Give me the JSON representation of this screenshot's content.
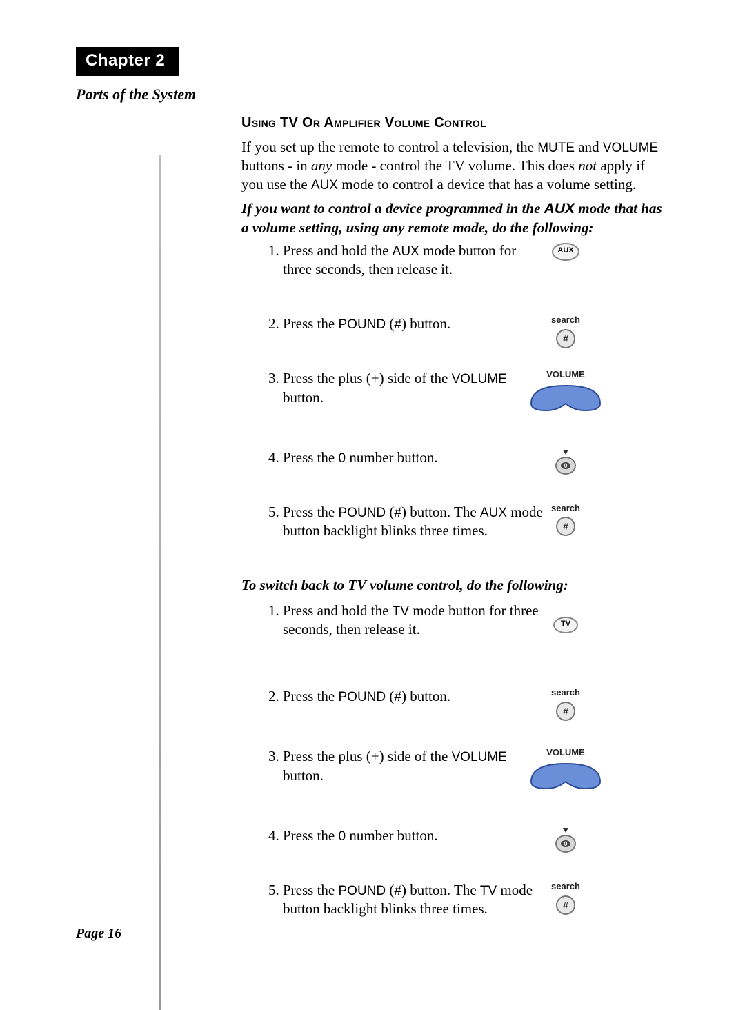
{
  "chapter": "Chapter 2",
  "section": "Parts of the System",
  "heading1": "Using TV Or Amplifier Volume Control",
  "intro_plain_a": "If you set up the remote to control a television, the ",
  "intro_mute": "MUTE",
  "intro_plain_b": " and ",
  "intro_volume": "VOLUME",
  "intro_plain_c": " buttons - in ",
  "intro_any": "any",
  "intro_plain_d": " mode - control the TV volume. This does ",
  "intro_not": "not",
  "intro_plain_e": " apply if you use the ",
  "intro_aux": "AUX",
  "intro_plain_f": " mode to control a device that has a volume setting.",
  "intro2_a": "If you want to control a device programmed in the ",
  "intro2_aux": "AUX",
  "intro2_b": " mode that has a volume setting, using any remote mode, do the following:",
  "stepsA": {
    "s1a": "Press and hold the ",
    "s1b": "AUX",
    "s1c": " mode button for three seconds, then release it.",
    "s2a": "Press the ",
    "s2b": "POUND",
    "s2c": " (",
    "s2d": "#",
    "s2e": ") button.",
    "s3a": "Press the plus (+) side of the ",
    "s3b": "VOLUME",
    "s3c": " button.",
    "s4a": "Press the ",
    "s4b": "0",
    "s4c": " number button.",
    "s5a": "Press the ",
    "s5b": "POUND",
    "s5c": " (",
    "s5d": "#",
    "s5e": ") button. The ",
    "s5f": "AUX",
    "s5g": " mode button backlight blinks three times."
  },
  "heading2": "To switch back to TV volume control, do the following:",
  "stepsB": {
    "s1a": "Press and hold the ",
    "s1b": "TV",
    "s1c": " mode button for three seconds, then release it.",
    "s2a": "Press the ",
    "s2b": "POUND",
    "s2c": " (",
    "s2d": "#",
    "s2e": ") button.",
    "s3a": "Press the plus (+) side of the ",
    "s3b": "VOLUME",
    "s3c": " button.",
    "s4a": "Press the ",
    "s4b": "0",
    "s4c": " number button.",
    "s5a": "Press the ",
    "s5b": "POUND",
    "s5c": " (",
    "s5d": "#",
    "s5e": ") button. The ",
    "s5f": "TV",
    "s5g": " mode button backlight blinks three times."
  },
  "labels": {
    "aux": "AUX",
    "tv": "TV",
    "search": "search",
    "pound": "#",
    "volume": "VOLUME",
    "zero": "0"
  },
  "pagenum": "Page 16"
}
